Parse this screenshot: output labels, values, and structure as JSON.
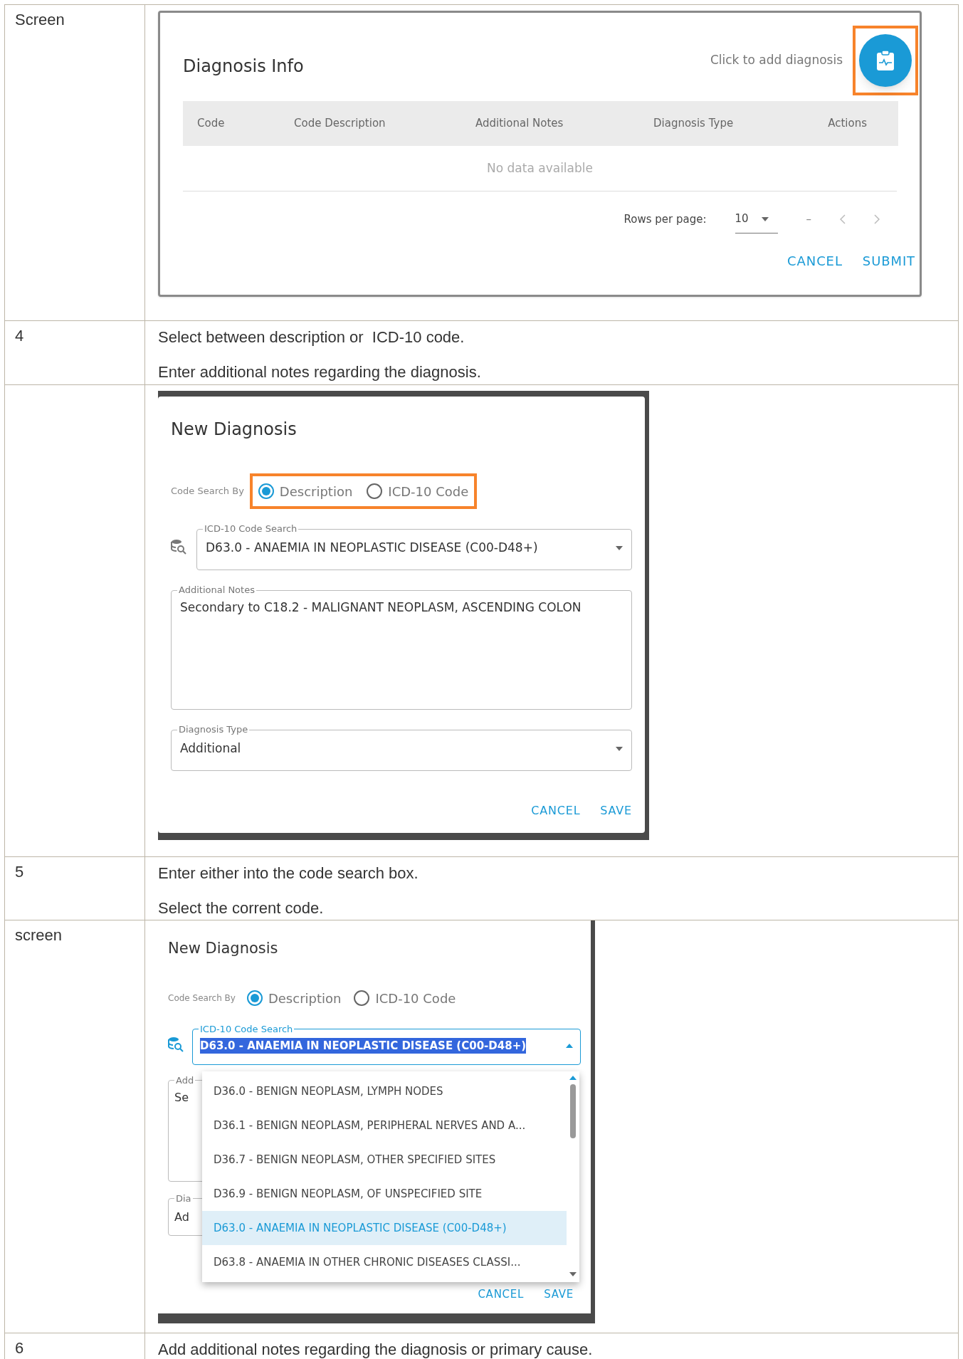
{
  "rows": [
    {
      "kind": "screenshot",
      "label": "Screen",
      "screen": {
        "kind": "diagnosis_info",
        "title": "Diagnosis Info",
        "hint": "Click to add diagnosis",
        "add_highlighted": true,
        "columns": [
          "Code",
          "Code Description",
          "Additional Notes",
          "Diagnosis Type",
          "Actions"
        ],
        "empty_text": "No data available",
        "rows_per_page_label": "Rows per page:",
        "rows_per_page": "10",
        "range": "–",
        "actions": [
          "CANCEL",
          "SUBMIT"
        ]
      }
    },
    {
      "kind": "step",
      "label": "4",
      "lines": [
        "Select between description or  ICD-10 code.",
        "Enter additional notes regarding the diagnosis."
      ]
    },
    {
      "kind": "screenshot",
      "screen": {
        "kind": "new_diagnosis",
        "title": "New Diagnosis",
        "search_by_label": "Code Search By",
        "options_highlighted": true,
        "options": [
          {
            "label": "Description",
            "selected": true
          },
          {
            "label": "ICD-10 Code",
            "selected": false
          }
        ],
        "code_search": {
          "label": "ICD-10 Code Search",
          "value": "D63.0 - ANAEMIA IN NEOPLASTIC DISEASE (C00-D48+)"
        },
        "notes": {
          "label": "Additional Notes",
          "value": "Secondary to C18.2 - MALIGNANT NEOPLASM, ASCENDING COLON"
        },
        "diagnosis_type": {
          "label": "Diagnosis Type",
          "value": "Additional"
        },
        "actions": [
          "CANCEL",
          "SAVE"
        ]
      }
    },
    {
      "kind": "step",
      "label": "5",
      "lines": [
        "Enter either into the code search box.",
        "Select the corrent code."
      ]
    },
    {
      "kind": "screenshot",
      "label": "screen",
      "screen": {
        "kind": "code_dropdown",
        "title": "New Diagnosis",
        "search_by_label": "Code Search By",
        "options": [
          {
            "label": "Description",
            "selected": true
          },
          {
            "label": "ICD-10 Code",
            "selected": false
          }
        ],
        "code_search": {
          "label": "ICD-10 Code Search",
          "value": "D63.0 - ANAEMIA IN NEOPLASTIC DISEASE (C00-D48+)"
        },
        "covered": {
          "notes_label": "Add",
          "notes_value": "Se",
          "type_label": "Dia",
          "type_value": "Ad"
        },
        "list": [
          {
            "label": "D36.0 - BENIGN NEOPLASM, LYMPH NODES",
            "selected": false
          },
          {
            "label": "D36.1 - BENIGN NEOPLASM, PERIPHERAL NERVES AND A...",
            "selected": false
          },
          {
            "label": "D36.7 - BENIGN NEOPLASM, OTHER SPECIFIED SITES",
            "selected": false
          },
          {
            "label": "D36.9 - BENIGN NEOPLASM, OF UNSPECIFIED SITE",
            "selected": false
          },
          {
            "label": "D63.0 - ANAEMIA IN NEOPLASTIC DISEASE (C00-D48+)",
            "selected": true
          },
          {
            "label": "D63.8 - ANAEMIA IN OTHER CHRONIC DISEASES CLASSI...",
            "selected": false
          }
        ],
        "actions": [
          "CANCEL",
          "SAVE"
        ]
      }
    },
    {
      "kind": "step",
      "label": "6",
      "lines": [
        "Add additional notes regarding the diagnosis or primary cause."
      ]
    }
  ]
}
